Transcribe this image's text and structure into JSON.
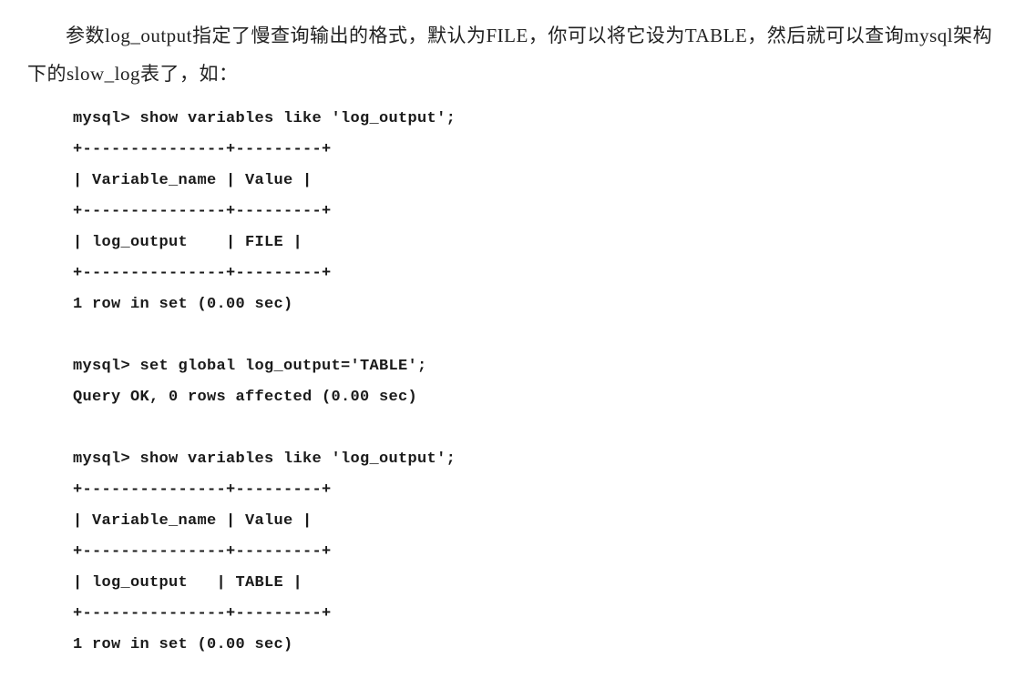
{
  "paragraph": "参数log_output指定了慢查询输出的格式，默认为FILE，你可以将它设为TABLE，然后就可以查询mysql架构下的slow_log表了，如：",
  "code": {
    "line01": "mysql> show variables like 'log_output';",
    "line02": "+---------------+---------+",
    "line03": "| Variable_name | Value |",
    "line04": "+---------------+---------+",
    "line05": "| log_output    | FILE |",
    "line06": "+---------------+---------+",
    "line07": "1 row in set (0.00 sec)",
    "line08": "",
    "line09": "mysql> set global log_output='TABLE';",
    "line10": "Query OK, 0 rows affected (0.00 sec)",
    "line11": "",
    "line12": "mysql> show variables like 'log_output';",
    "line13": "+---------------+---------+",
    "line14": "| Variable_name | Value |",
    "line15": "+---------------+---------+",
    "line16": "| log_output   | TABLE |",
    "line17": "+---------------+---------+",
    "line18": "1 row in set (0.00 sec)"
  }
}
